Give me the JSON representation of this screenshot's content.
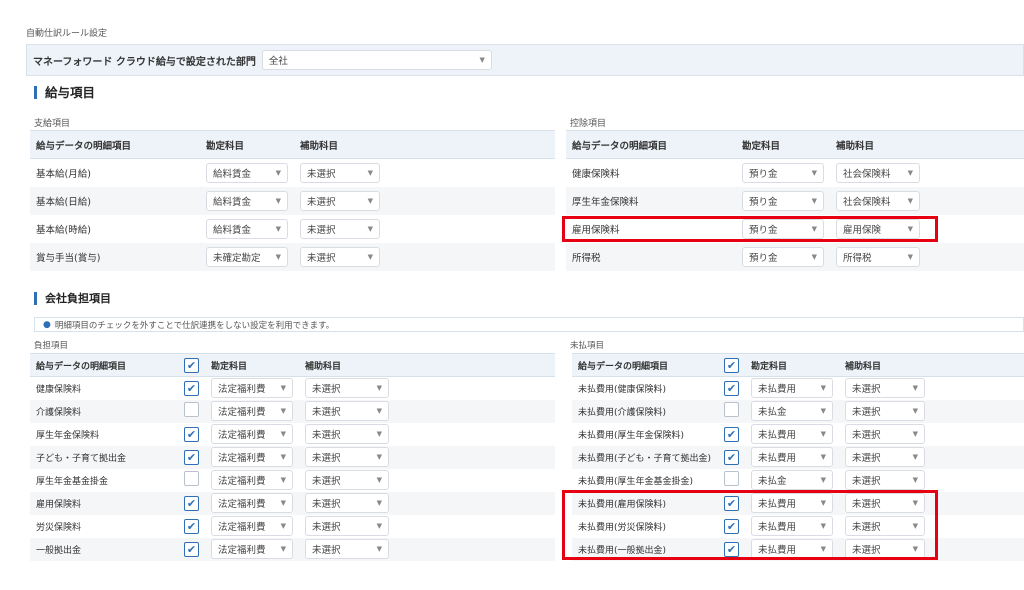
{
  "header": {
    "title": "自動仕訳ルール設定"
  },
  "department": {
    "label": "マネーフォワード クラウド給与で設定された部門",
    "value": "全社"
  },
  "salary_section": {
    "title": "給与項目",
    "payments": {
      "caption": "支給項目",
      "headers": [
        "給与データの明細項目",
        "勘定科目",
        "補助科目"
      ],
      "rows": [
        {
          "item": "基本給(月給)",
          "account": "給料賃金",
          "sub": "未選択"
        },
        {
          "item": "基本給(日給)",
          "account": "給料賃金",
          "sub": "未選択"
        },
        {
          "item": "基本給(時給)",
          "account": "給料賃金",
          "sub": "未選択"
        },
        {
          "item": "賞与手当(賞与)",
          "account": "未確定勘定",
          "sub": "未選択"
        }
      ]
    },
    "deductions": {
      "caption": "控除項目",
      "headers": [
        "給与データの明細項目",
        "勘定科目",
        "補助科目"
      ],
      "rows": [
        {
          "item": "健康保険料",
          "account": "預り金",
          "sub": "社会保険料"
        },
        {
          "item": "厚生年金保険料",
          "account": "預り金",
          "sub": "社会保険料"
        },
        {
          "item": "雇用保険料",
          "account": "預り金",
          "sub": "雇用保険"
        },
        {
          "item": "所得税",
          "account": "預り金",
          "sub": "所得税"
        }
      ]
    }
  },
  "company_section": {
    "title": "会社負担項目",
    "notice": "明細項目のチェックを外すことで仕訳連携をしない設定を利用できます。",
    "burden": {
      "caption": "負担項目",
      "headers": [
        "給与データの明細項目",
        "勘定科目",
        "補助科目"
      ],
      "rows": [
        {
          "item": "健康保険料",
          "checked": true,
          "account": "法定福利費",
          "sub": "未選択"
        },
        {
          "item": "介護保険料",
          "checked": false,
          "account": "法定福利費",
          "sub": "未選択"
        },
        {
          "item": "厚生年金保険料",
          "checked": true,
          "account": "法定福利費",
          "sub": "未選択"
        },
        {
          "item": "子ども・子育て拠出金",
          "checked": true,
          "account": "法定福利費",
          "sub": "未選択"
        },
        {
          "item": "厚生年金基金掛金",
          "checked": false,
          "account": "法定福利費",
          "sub": "未選択"
        },
        {
          "item": "雇用保険料",
          "checked": true,
          "account": "法定福利費",
          "sub": "未選択"
        },
        {
          "item": "労災保険料",
          "checked": true,
          "account": "法定福利費",
          "sub": "未選択"
        },
        {
          "item": "一般拠出金",
          "checked": true,
          "account": "法定福利費",
          "sub": "未選択"
        }
      ]
    },
    "unpaid": {
      "caption": "未払項目",
      "headers": [
        "給与データの明細項目",
        "勘定科目",
        "補助科目"
      ],
      "rows": [
        {
          "item": "未払費用(健康保険料)",
          "checked": true,
          "account": "未払費用",
          "sub": "未選択"
        },
        {
          "item": "未払費用(介護保険料)",
          "checked": false,
          "account": "未払金",
          "sub": "未選択"
        },
        {
          "item": "未払費用(厚生年金保険料)",
          "checked": true,
          "account": "未払費用",
          "sub": "未選択"
        },
        {
          "item": "未払費用(子ども・子育て拠出金)",
          "checked": true,
          "account": "未払費用",
          "sub": "未選択"
        },
        {
          "item": "未払費用(厚生年金基金掛金)",
          "checked": false,
          "account": "未払金",
          "sub": "未選択"
        },
        {
          "item": "未払費用(雇用保険料)",
          "checked": true,
          "account": "未払費用",
          "sub": "未選択"
        },
        {
          "item": "未払費用(労災保険料)",
          "checked": true,
          "account": "未払費用",
          "sub": "未選択"
        },
        {
          "item": "未払費用(一般拠出金)",
          "checked": true,
          "account": "未払費用",
          "sub": "未選択"
        }
      ]
    }
  },
  "icons": {
    "dropdown": "chevron-down-icon",
    "check": "check-icon",
    "info": "info-icon"
  },
  "colors": {
    "accent": "#2f6fb5",
    "highlight": "#e60012",
    "header_bg": "#edf3f9"
  }
}
